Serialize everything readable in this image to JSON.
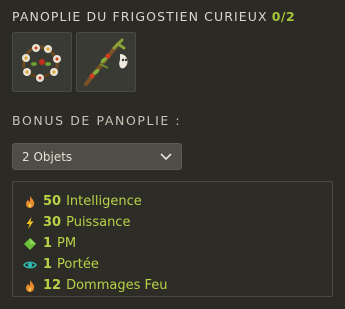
{
  "set": {
    "title": "PANOPLIE DU FRIGOSTIEN CURIEUX",
    "count": "0/2",
    "items": [
      {
        "icon": "flower-garland-amulet-icon"
      },
      {
        "icon": "forked-staff-icon"
      }
    ]
  },
  "bonus_section": {
    "label": "BONUS DE PANOPLIE :",
    "selected": "2 Objets"
  },
  "bonuses": [
    {
      "icon": "fire-icon",
      "value": "50",
      "label": "Intelligence",
      "color": "#e8892a"
    },
    {
      "icon": "lightning-icon",
      "value": "30",
      "label": "Puissance",
      "color": "#f0c020"
    },
    {
      "icon": "diamond-icon",
      "value": "1",
      "label": "PM",
      "color": "#6cbf3a"
    },
    {
      "icon": "eye-icon",
      "value": "1",
      "label": "Portée",
      "color": "#2fbcb0"
    },
    {
      "icon": "fire-icon",
      "value": "12",
      "label": "Dommages Feu",
      "color": "#e8892a"
    }
  ],
  "colors": {
    "background": "#2b2a25",
    "accent_green": "#b9d146",
    "count_green": "#a4c43a"
  }
}
